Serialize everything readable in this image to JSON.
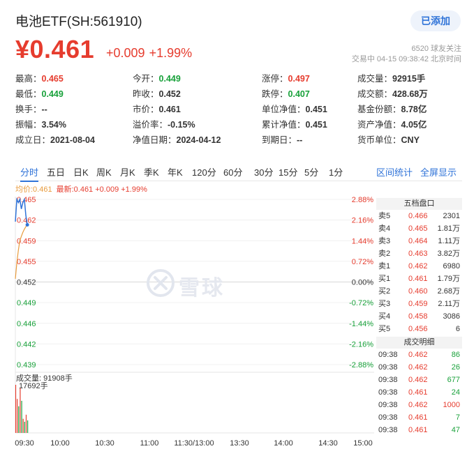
{
  "header": {
    "title": "电池ETF(SH:561910)",
    "added_label": "已添加",
    "price": "¥0.461",
    "change": "+0.009",
    "change_pct": "+1.99%",
    "followers": "6520 球友关注",
    "status_time": "交易中 04-15 09:38:42 北京时间"
  },
  "stats": [
    [
      {
        "label": "最高：",
        "value": "0.465",
        "color": "red"
      },
      {
        "label": "今开：",
        "value": "0.449",
        "color": "green"
      },
      {
        "label": "涨停：",
        "value": "0.497",
        "color": "red"
      },
      {
        "label": "成交量：",
        "value": "92915手",
        "color": ""
      }
    ],
    [
      {
        "label": "最低：",
        "value": "0.449",
        "color": "green"
      },
      {
        "label": "昨收：",
        "value": "0.452",
        "color": ""
      },
      {
        "label": "跌停：",
        "value": "0.407",
        "color": "green"
      },
      {
        "label": "成交额：",
        "value": "428.68万",
        "color": ""
      }
    ],
    [
      {
        "label": "换手：",
        "value": "--",
        "color": ""
      },
      {
        "label": "市价：",
        "value": "0.461",
        "color": ""
      },
      {
        "label": "单位净值：",
        "value": "0.451",
        "color": ""
      },
      {
        "label": "基金份额：",
        "value": "8.78亿",
        "color": ""
      }
    ],
    [
      {
        "label": "振幅：",
        "value": "3.54%",
        "color": ""
      },
      {
        "label": "溢价率：",
        "value": "-0.15%",
        "color": ""
      },
      {
        "label": "累计净值：",
        "value": "0.451",
        "color": ""
      },
      {
        "label": "资产净值：",
        "value": "4.05亿",
        "color": ""
      }
    ],
    [
      {
        "label": "成立日：",
        "value": "2021-08-04",
        "color": ""
      },
      {
        "label": "净值日期：",
        "value": "2024-04-12",
        "color": ""
      },
      {
        "label": "到期日：",
        "value": "--",
        "color": ""
      },
      {
        "label": "货币单位：",
        "value": "CNY",
        "color": ""
      }
    ]
  ],
  "tabs": [
    "分时",
    "五日",
    "日K",
    "周K",
    "月K",
    "季K",
    "年K",
    "120分",
    "60分",
    "30分",
    "15分",
    "5分",
    "1分"
  ],
  "active_tab": "分时",
  "tab_links": [
    "区间统计",
    "全屏显示"
  ],
  "legend": {
    "avg": "均价:0.461",
    "latest": "最新:0.461 +0.009 +1.99%"
  },
  "watermark_text": "雪球",
  "volume_label": "成交量: 91908手",
  "volume_max_label": "17692手",
  "colors": {
    "up": "#e63c2e",
    "down": "#18a13a",
    "price_line": "#2f73d8",
    "avg_line": "#e89b3c",
    "link": "#2f73d8"
  },
  "order_book": {
    "title": "五档盘口",
    "rows": [
      {
        "side": "卖5",
        "price": "0.466",
        "vol": "2301"
      },
      {
        "side": "卖4",
        "price": "0.465",
        "vol": "1.81万"
      },
      {
        "side": "卖3",
        "price": "0.464",
        "vol": "1.11万"
      },
      {
        "side": "卖2",
        "price": "0.463",
        "vol": "3.82万"
      },
      {
        "side": "卖1",
        "price": "0.462",
        "vol": "6980"
      },
      {
        "side": "买1",
        "price": "0.461",
        "vol": "1.79万"
      },
      {
        "side": "买2",
        "price": "0.460",
        "vol": "2.68万"
      },
      {
        "side": "买3",
        "price": "0.459",
        "vol": "2.11万"
      },
      {
        "side": "买4",
        "price": "0.458",
        "vol": "3086"
      },
      {
        "side": "买5",
        "price": "0.456",
        "vol": "6"
      }
    ]
  },
  "trades": {
    "title": "成交明细",
    "rows": [
      {
        "time": "09:38",
        "price": "0.462",
        "vol": "86",
        "dir": "green"
      },
      {
        "time": "09:38",
        "price": "0.462",
        "vol": "26",
        "dir": "green"
      },
      {
        "time": "09:38",
        "price": "0.462",
        "vol": "677",
        "dir": "green"
      },
      {
        "time": "09:38",
        "price": "0.461",
        "vol": "24",
        "dir": "green"
      },
      {
        "time": "09:38",
        "price": "0.462",
        "vol": "1000",
        "dir": "red"
      },
      {
        "time": "09:38",
        "price": "0.461",
        "vol": "7",
        "dir": "green"
      },
      {
        "time": "09:38",
        "price": "0.461",
        "vol": "47",
        "dir": "green"
      }
    ]
  },
  "chart_data": {
    "type": "line",
    "title": "",
    "prev_close": 0.452,
    "y_ticks_left": [
      "0.465",
      "0.462",
      "0.459",
      "0.455",
      "0.452",
      "0.449",
      "0.446",
      "0.442",
      "0.439"
    ],
    "y_ticks_right": [
      "2.88%",
      "2.16%",
      "1.44%",
      "0.72%",
      "0.00%",
      "-0.72%",
      "-1.44%",
      "-2.16%",
      "-2.88%"
    ],
    "x_ticks": [
      "09:30",
      "10:00",
      "10:30",
      "11:00",
      "11:30/13:00",
      "13:30",
      "14:00",
      "14:30",
      "15:00"
    ],
    "ylim": [
      0.439,
      0.465
    ],
    "total_minutes": 240,
    "series": [
      {
        "name": "最新",
        "x": [
          0,
          1,
          2,
          3,
          4,
          5,
          6,
          7,
          8
        ],
        "values": [
          0.4615,
          0.465,
          0.4645,
          0.465,
          0.4635,
          0.4645,
          0.465,
          0.4625,
          0.461
        ]
      },
      {
        "name": "均价",
        "x": [
          0,
          1,
          2,
          3,
          4,
          5,
          6,
          7,
          8
        ],
        "values": [
          0.4525,
          0.455,
          0.457,
          0.4585,
          0.4592,
          0.4598,
          0.4603,
          0.4607,
          0.461
        ]
      }
    ],
    "volume": {
      "x": [
        0,
        1,
        2,
        3,
        4,
        5,
        6,
        7,
        8
      ],
      "values": [
        17692,
        12500,
        9800,
        16500,
        11800,
        5200,
        4100,
        6700,
        4600
      ],
      "colors": [
        "red",
        "red",
        "green",
        "red",
        "green",
        "red",
        "green",
        "red",
        "green"
      ]
    }
  }
}
